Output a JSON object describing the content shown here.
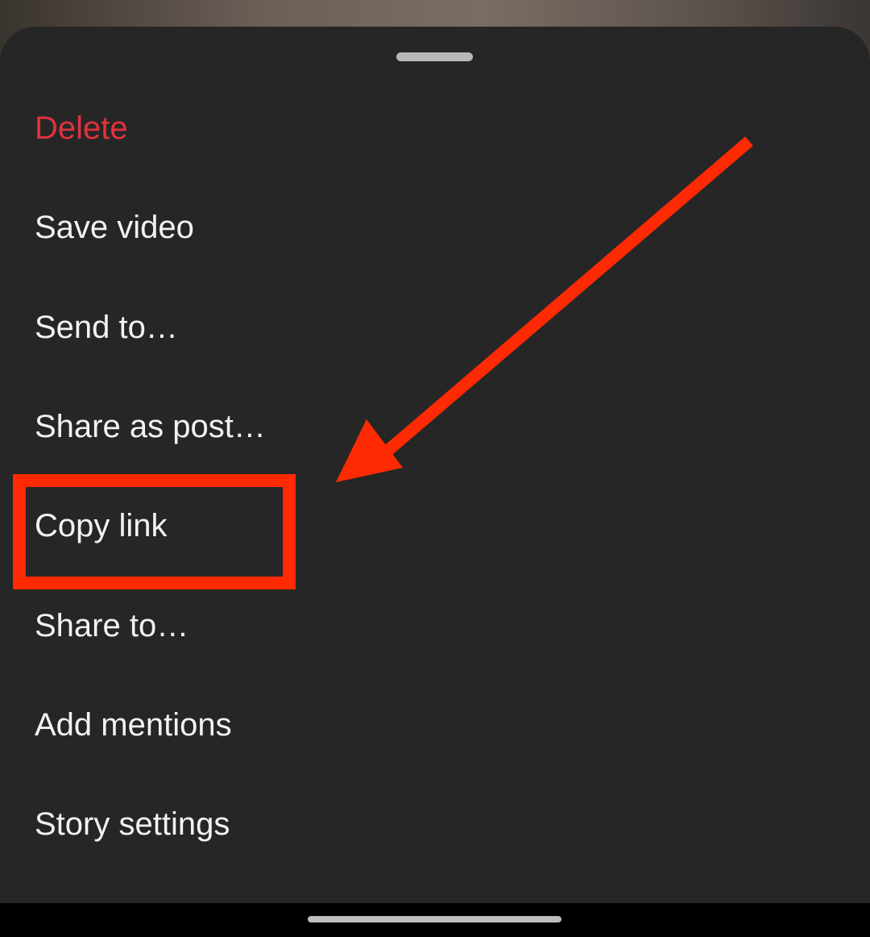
{
  "menu": {
    "items": [
      {
        "label": "Delete",
        "style": "danger"
      },
      {
        "label": "Save video",
        "style": "normal"
      },
      {
        "label": "Send to…",
        "style": "normal"
      },
      {
        "label": "Share as post…",
        "style": "normal"
      },
      {
        "label": "Copy link",
        "style": "normal"
      },
      {
        "label": "Share to…",
        "style": "normal"
      },
      {
        "label": "Add mentions",
        "style": "normal"
      },
      {
        "label": "Story settings",
        "style": "normal"
      }
    ]
  },
  "colors": {
    "sheet_background": "#262626",
    "text": "#f2f2f2",
    "danger": "#e0323c",
    "annotation": "#fe2a03"
  },
  "annotation": {
    "highlighted_item": "Copy link",
    "arrow_icon": "arrow-icon"
  }
}
